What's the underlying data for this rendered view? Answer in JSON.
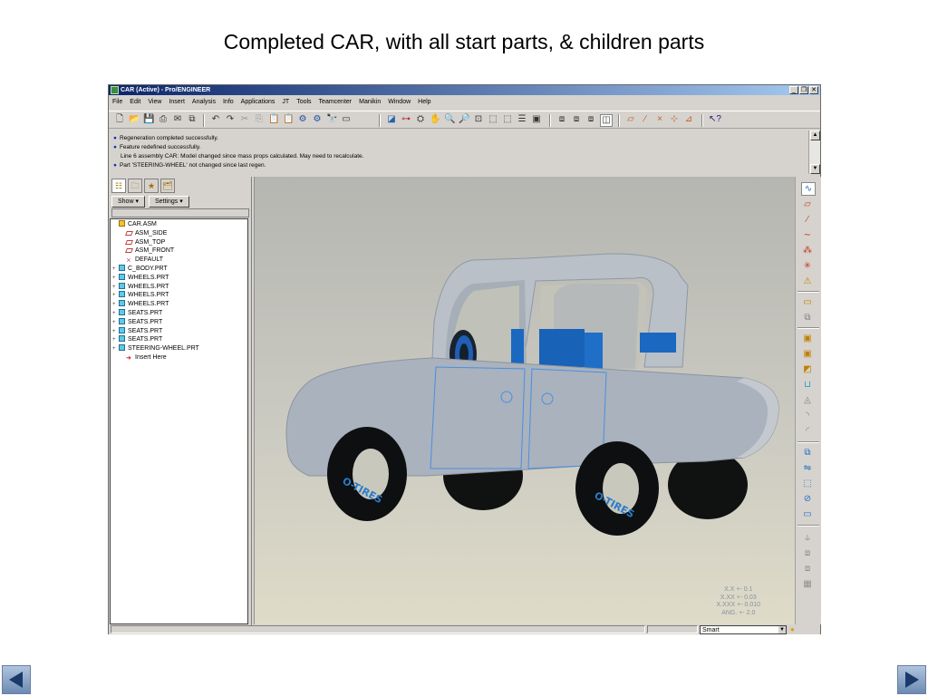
{
  "slide": {
    "title": "Completed CAR, with all start parts, & children parts"
  },
  "window": {
    "title": "CAR (Active) - Pro/ENGINEER",
    "controls": [
      "minimize-icon",
      "restore-icon",
      "close-icon"
    ]
  },
  "menu": [
    "File",
    "Edit",
    "View",
    "Insert",
    "Analysis",
    "Info",
    "Applications",
    "JT",
    "Tools",
    "Teamcenter",
    "Manikin",
    "Window",
    "Help"
  ],
  "messages": [
    {
      "bullet": true,
      "text": "Regeneration completed successfully."
    },
    {
      "bullet": true,
      "text": "Feature redefined successfully."
    },
    {
      "bullet": false,
      "text": "Line 6 assembly CAR: Model changed since mass props calculated. May need to recalculate."
    },
    {
      "bullet": true,
      "text": "Part 'STEERING-WHEEL' not changed since last regen."
    }
  ],
  "navigator": {
    "show_label": "Show",
    "settings_label": "Settings",
    "tree": [
      {
        "label": "CAR.ASM",
        "icon": "asm",
        "level": 0,
        "expander": ""
      },
      {
        "label": "ASM_SIDE",
        "icon": "datum",
        "level": 1,
        "expander": ""
      },
      {
        "label": "ASM_TOP",
        "icon": "datum",
        "level": 1,
        "expander": ""
      },
      {
        "label": "ASM_FRONT",
        "icon": "datum",
        "level": 1,
        "expander": ""
      },
      {
        "label": "DEFAULT",
        "icon": "csys",
        "level": 1,
        "expander": ""
      },
      {
        "label": "C_BODY.PRT",
        "icon": "prt",
        "level": 0,
        "expander": "+"
      },
      {
        "label": "WHEELS.PRT",
        "icon": "prt",
        "level": 0,
        "expander": "+"
      },
      {
        "label": "WHEELS.PRT",
        "icon": "prt",
        "level": 0,
        "expander": "+"
      },
      {
        "label": "WHEELS.PRT",
        "icon": "prt",
        "level": 0,
        "expander": "+"
      },
      {
        "label": "WHEELS.PRT",
        "icon": "prt",
        "level": 0,
        "expander": "+"
      },
      {
        "label": "SEATS.PRT",
        "icon": "prt",
        "level": 0,
        "expander": "+"
      },
      {
        "label": "SEATS.PRT",
        "icon": "prt",
        "level": 0,
        "expander": "+"
      },
      {
        "label": "SEATS.PRT",
        "icon": "prt",
        "level": 0,
        "expander": "+"
      },
      {
        "label": "SEATS.PRT",
        "icon": "prt",
        "level": 0,
        "expander": "+"
      },
      {
        "label": "STEERING-WHEEL.PRT",
        "icon": "prt",
        "level": 0,
        "expander": "+"
      },
      {
        "label": "Insert Here",
        "icon": "insert",
        "level": 1,
        "expander": ""
      }
    ]
  },
  "viewport": {
    "tolerances": [
      "X.X +- 0.1",
      "X.XX +- 0.03",
      "X.XXX +- 0.010",
      "ANG. +- 2.0"
    ],
    "tire_text": "O-TIRES"
  },
  "status": {
    "filter_value": "Smart"
  }
}
